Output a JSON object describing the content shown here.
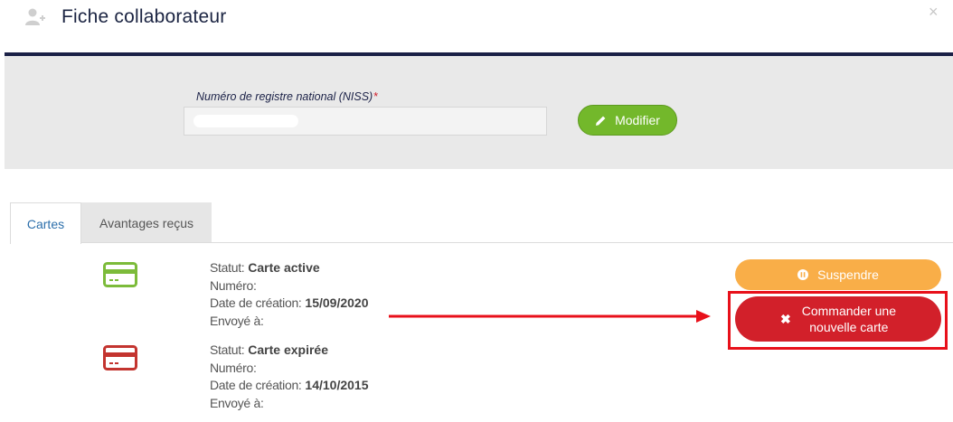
{
  "header": {
    "title": "Fiche collaborateur",
    "close_label": "×"
  },
  "niss": {
    "label": "Numéro de registre national (NISS)",
    "required_mark": "*",
    "value": ""
  },
  "buttons": {
    "modifier": "Modifier",
    "suspendre": "Suspendre",
    "commander_line1": "Commander une",
    "commander_line2": "nouvelle carte"
  },
  "tabs": [
    {
      "label": "Cartes",
      "active": true
    },
    {
      "label": "Avantages reçus",
      "active": false
    }
  ],
  "cards": [
    {
      "statut_label": "Statut:",
      "statut_value": "Carte active",
      "numero_label": "Numéro:",
      "date_label": "Date de création:",
      "date_value": "15/09/2020",
      "envoye_label": "Envoyé à:",
      "color": "#7cbb3a"
    },
    {
      "statut_label": "Statut:",
      "statut_value": "Carte expirée",
      "numero_label": "Numéro:",
      "date_label": "Date de création:",
      "date_value": "14/10/2015",
      "envoye_label": "Envoyé à:",
      "color": "#c3342f"
    }
  ],
  "colors": {
    "navy": "#1b2147",
    "green": "#73b82b",
    "orange": "#f9ae48",
    "red": "#d2202a",
    "highlight": "#e8101a"
  }
}
